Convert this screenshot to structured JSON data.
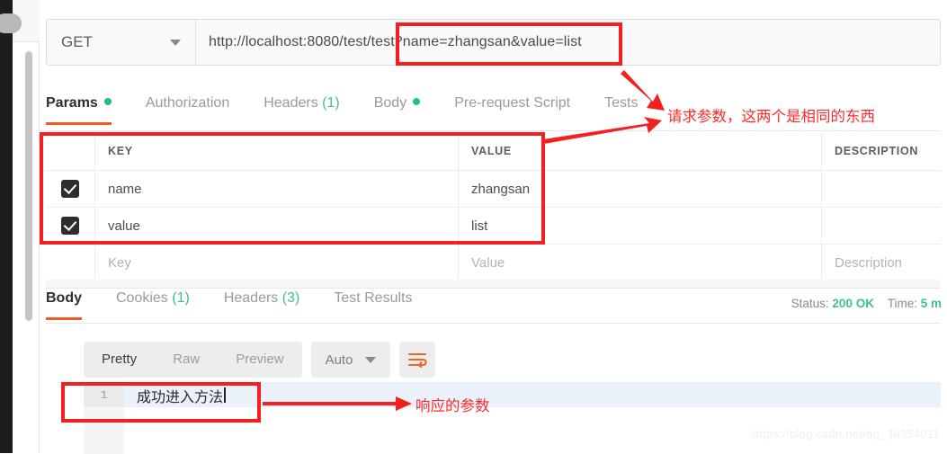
{
  "request": {
    "method": "GET",
    "url": "http://localhost:8080/test/test?name=zhangsan&value=list",
    "tabs": [
      {
        "label": "Params",
        "marker": "dot",
        "active": true
      },
      {
        "label": "Authorization",
        "marker": "",
        "active": false
      },
      {
        "label": "Headers",
        "marker": "(1)",
        "active": false
      },
      {
        "label": "Body",
        "marker": "dot",
        "active": false
      },
      {
        "label": "Pre-request Script",
        "marker": "",
        "active": false
      },
      {
        "label": "Tests",
        "marker": "",
        "active": false
      }
    ],
    "table": {
      "headers": {
        "key": "KEY",
        "value": "VALUE",
        "description": "DESCRIPTION"
      },
      "rows": [
        {
          "checked": true,
          "key": "name",
          "value": "zhangsan",
          "description": ""
        },
        {
          "checked": true,
          "key": "value",
          "value": "list",
          "description": ""
        }
      ],
      "placeholder_row": {
        "key": "Key",
        "value": "Value",
        "description": "Description"
      }
    }
  },
  "response": {
    "tabs": [
      {
        "label": "Body",
        "marker": "",
        "active": true
      },
      {
        "label": "Cookies",
        "marker": "(1)",
        "active": false
      },
      {
        "label": "Headers",
        "marker": "(3)",
        "active": false
      },
      {
        "label": "Test Results",
        "marker": "",
        "active": false
      }
    ],
    "status_label": "Status:",
    "status_value": "200 OK",
    "time_label": "Time:",
    "time_value": "5 m",
    "toolbar": {
      "pretty": "Pretty",
      "raw": "Raw",
      "preview": "Preview",
      "format": "Auto"
    },
    "body": {
      "line_number": "1",
      "text": "成功进入方法"
    }
  },
  "annotations": {
    "request_params_note": "请求参数，这两个是相同的东西",
    "response_params_note": "响应的参数",
    "color": "#f42020"
  },
  "watermark": "https://blog.csdn.net/qq_36354011"
}
